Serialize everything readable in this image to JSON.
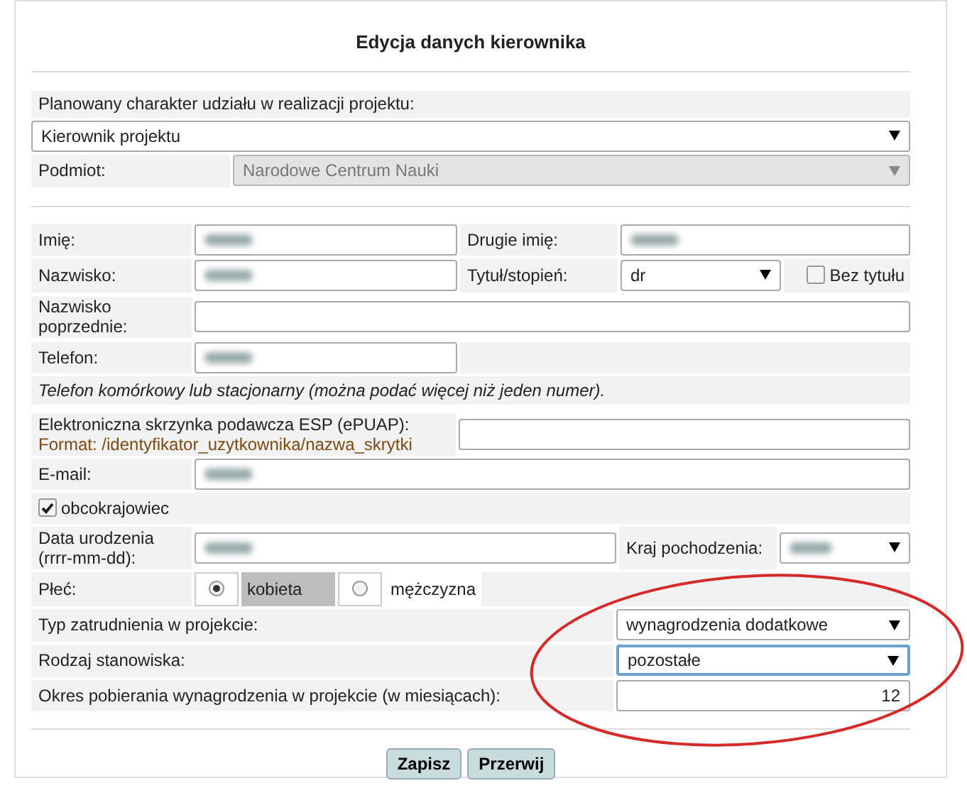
{
  "title": "Edycja danych kierownika",
  "participation": {
    "label": "Planowany charakter udziału w realizacji projektu:",
    "value": "Kierownik projektu"
  },
  "entity": {
    "label": "Podmiot:",
    "value": "Narodowe Centrum Nauki",
    "disabled": true
  },
  "first_name": {
    "label": "Imię:",
    "blurred": true
  },
  "middle_name": {
    "label": "Drugie imię:",
    "blurred": true
  },
  "last_name": {
    "label": "Nazwisko:",
    "blurred": true
  },
  "degree": {
    "label": "Tytuł/stopień:",
    "value": "dr"
  },
  "no_title": {
    "label": "Bez tytułu",
    "checked": false
  },
  "previous_name": {
    "label": "Nazwisko poprzednie:",
    "blurred": false
  },
  "phone": {
    "label": "Telefon:",
    "blurred": true
  },
  "phone_hint": "Telefon komórkowy lub stacjonarny (można podać więcej niż jeden numer).",
  "esp": {
    "label": "Elektroniczna skrzynka podawcza ESP (ePUAP):",
    "format": "Format: /identyfikator_uzytkownika/nazwa_skrytki",
    "blurred": false
  },
  "email": {
    "label": "E-mail:",
    "blurred": true
  },
  "foreigner": {
    "label": "obcokrajowiec",
    "checked": true
  },
  "birth_date": {
    "label": "Data urodzenia (rrrr-mm-dd):",
    "blurred": true
  },
  "country": {
    "label": "Kraj pochodzenia:",
    "blurred": true
  },
  "gender": {
    "label": "Płeć:",
    "options": [
      {
        "label": "kobieta",
        "selected": true
      },
      {
        "label": "mężczyzna",
        "selected": false
      }
    ]
  },
  "employment_type": {
    "label": "Typ zatrudnienia w projekcie:",
    "value": "wynagrodzenia dodatkowe",
    "focused": false
  },
  "position_type": {
    "label": "Rodzaj stanowiska:",
    "value": "pozostałe",
    "focused": true
  },
  "salary_period": {
    "label": "Okres pobierania wynagrodzenia w projekcie (w miesiącach):",
    "value": "12"
  },
  "buttons": [
    "Zapisz",
    "Przerwij"
  ]
}
